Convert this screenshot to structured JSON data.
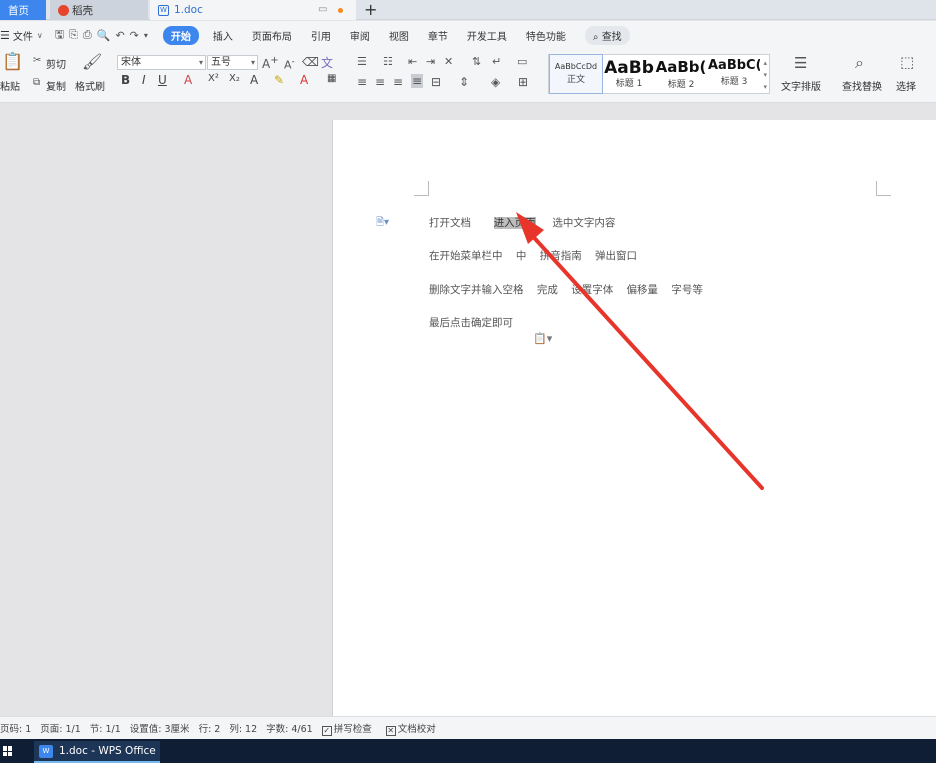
{
  "tabs": {
    "home": "首页",
    "docer": "稻壳",
    "doc": "1.doc",
    "new_tab": "+"
  },
  "menu": {
    "file": "文件",
    "items": [
      "插入",
      "页面布局",
      "引用",
      "审阅",
      "视图",
      "章节",
      "开发工具",
      "特色功能"
    ],
    "active": "开始",
    "search": "查找"
  },
  "ribbon": {
    "paste": "粘贴",
    "cut": "剪切",
    "copy": "复制",
    "format_painter": "格式刷",
    "font_name": "宋体",
    "font_size": "五号",
    "text_layout": "文字排版",
    "find_replace": "查找替换",
    "select": "选择",
    "styles": [
      {
        "preview": "AaBbCcDd",
        "name": "正文"
      },
      {
        "preview": "AaBb",
        "name": "标题 1"
      },
      {
        "preview": "AaBb(",
        "name": "标题 2"
      },
      {
        "preview": "AaBbC(",
        "name": "标题 3"
      }
    ]
  },
  "document": {
    "line1_a": "打开文档",
    "line1_sel": "进入页面",
    "line1_b": "选中文字内容",
    "line2": "在开始菜单栏中    中    拼音指南    弹出窗口",
    "line3": "删除文字并输入空格    完成    设置字体    偏移量    字号等",
    "line4": "最后点击确定即可"
  },
  "status": {
    "page_code": "页码: 1",
    "pages": "页面: 1/1",
    "section": "节: 1/1",
    "setting": "设置值: 3厘米",
    "row": "行: 2",
    "col": "列: 12",
    "words": "字数: 4/61",
    "spell": "拼写检查",
    "proof": "文档校对"
  },
  "taskbar": {
    "app": "1.doc - WPS Office"
  },
  "colors": {
    "accent": "#3d86ee",
    "arrow": "#e8352b",
    "taskbar": "#0f1e35"
  }
}
